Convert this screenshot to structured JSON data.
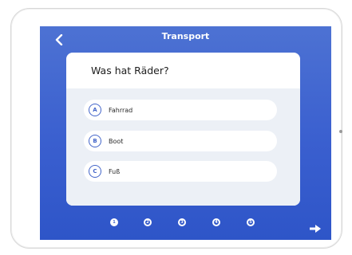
{
  "screen": {
    "title": "Transport",
    "back_icon": "back-chevron-icon",
    "next_icon": "arrow-right-icon"
  },
  "question": {
    "text": "Was hat Räder?",
    "options": [
      {
        "letter": "A",
        "label": "Fahrrad"
      },
      {
        "letter": "B",
        "label": "Boot"
      },
      {
        "letter": "C",
        "label": "Fuß"
      }
    ]
  },
  "pagination": {
    "current": 1,
    "pages": [
      "1",
      "2",
      "3",
      "4",
      "5"
    ]
  },
  "colors": {
    "screen_top": "#4d72d3",
    "screen_bottom": "#2e55c8",
    "accent": "#4365c9",
    "answer_panel": "#ecf0f6"
  }
}
